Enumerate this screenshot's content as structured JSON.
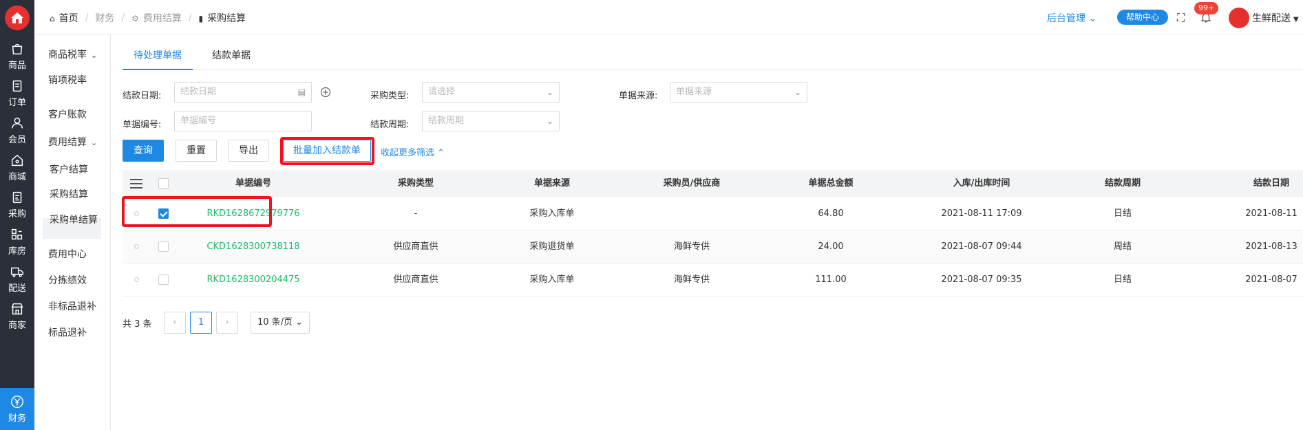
{
  "rail": {
    "items": [
      {
        "label": "商品",
        "icon": "bag-icon"
      },
      {
        "label": "订单",
        "icon": "order-icon"
      },
      {
        "label": "会员",
        "icon": "member-icon"
      },
      {
        "label": "商城",
        "icon": "mall-icon"
      },
      {
        "label": "采购",
        "icon": "purchase-icon"
      },
      {
        "label": "库房",
        "icon": "warehouse-icon"
      },
      {
        "label": "配送",
        "icon": "delivery-icon"
      },
      {
        "label": "商家",
        "icon": "shop-icon"
      },
      {
        "label": "财务",
        "icon": "yen-icon",
        "active": true
      }
    ]
  },
  "subnav": {
    "items": [
      {
        "label": "商品税率",
        "expand": true
      },
      {
        "label": "销项税率"
      },
      {
        "label": "客户账款"
      },
      {
        "label": "费用结算",
        "expand": true
      },
      {
        "label": "客户结算"
      },
      {
        "label": "采购结算",
        "active": true
      },
      {
        "label": "采购单结算"
      },
      {
        "label": "费用中心"
      },
      {
        "label": "分拣绩效"
      },
      {
        "label": "非标品退补"
      },
      {
        "label": "标品退补"
      }
    ]
  },
  "header": {
    "breadcrumb": [
      "首页",
      "财务",
      "费用结算",
      "采购结算"
    ],
    "admin_label": "后台管理",
    "help_label": "帮助中心",
    "badge": "99+",
    "username": "生鲜配送"
  },
  "tabs": [
    "待处理单据",
    "结款单据"
  ],
  "filters": {
    "settle_date_label": "结款日期:",
    "settle_date_placeholder": "结款日期",
    "purchase_type_label": "采购类型:",
    "purchase_type_placeholder": "请选择",
    "source_label": "单据来源:",
    "source_placeholder": "单据来源",
    "doc_no_label": "单据编号:",
    "doc_no_placeholder": "单据编号",
    "period_label": "结款周期:",
    "period_placeholder": "结款周期"
  },
  "actions": {
    "query": "查询",
    "reset": "重置",
    "export": "导出",
    "batch_add": "批量加入结款单",
    "collapse": "收起更多筛选"
  },
  "table": {
    "columns": [
      "单据编号",
      "采购类型",
      "单据来源",
      "采购员/供应商",
      "单据总金额",
      "入库/出库时间",
      "结款周期",
      "结款日期"
    ],
    "rows": [
      {
        "checked": true,
        "cells": [
          "RKD1628672979776",
          "-",
          "采购入库单",
          "",
          "64.80",
          "2021-08-11 17:09",
          "日结",
          "2021-08-11"
        ]
      },
      {
        "checked": false,
        "cells": [
          "CKD1628300738118",
          "供应商直供",
          "采购退货单",
          "海鲜专供",
          "24.00",
          "2021-08-07 09:44",
          "周结",
          "2021-08-13"
        ]
      },
      {
        "checked": false,
        "cells": [
          "RKD1628300204475",
          "供应商直供",
          "采购入库单",
          "海鲜专供",
          "111.00",
          "2021-08-07 09:35",
          "日结",
          "2021-08-07"
        ]
      }
    ]
  },
  "pagination": {
    "total": "共 3 条",
    "current": "1",
    "page_size": "10 条/页"
  }
}
